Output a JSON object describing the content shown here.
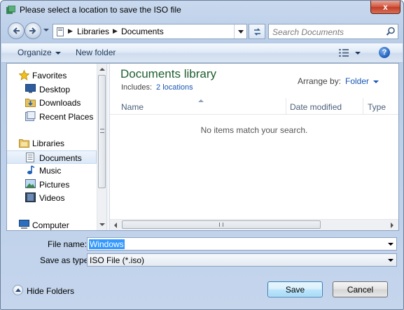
{
  "window": {
    "title": "Please select a location to save the ISO file",
    "close_label": "x"
  },
  "address": {
    "crumbs": [
      "Libraries",
      "Documents"
    ]
  },
  "search": {
    "placeholder": "Search Documents"
  },
  "toolbar": {
    "organize_label": "Organize",
    "new_folder_label": "New folder",
    "help_label": "?"
  },
  "nav": {
    "favorites": "Favorites",
    "desktop": "Desktop",
    "downloads": "Downloads",
    "recent_places": "Recent Places",
    "libraries": "Libraries",
    "documents": "Documents",
    "music": "Music",
    "pictures": "Pictures",
    "videos": "Videos",
    "computer": "Computer"
  },
  "library": {
    "title": "Documents library",
    "includes_label": "Includes:",
    "locations_link": "2 locations",
    "arrange_label": "Arrange by:",
    "arrange_value": "Folder"
  },
  "columns": {
    "name": "Name",
    "date_modified": "Date modified",
    "type": "Type"
  },
  "empty_message": "No items match your search.",
  "form": {
    "file_name_label": "File name:",
    "file_name_value": "Windows",
    "save_as_type_label": "Save as type:",
    "save_as_type_value": "ISO File (*.iso)"
  },
  "footer": {
    "hide_folders_label": "Hide Folders",
    "save_label": "Save",
    "cancel_label": "Cancel"
  }
}
